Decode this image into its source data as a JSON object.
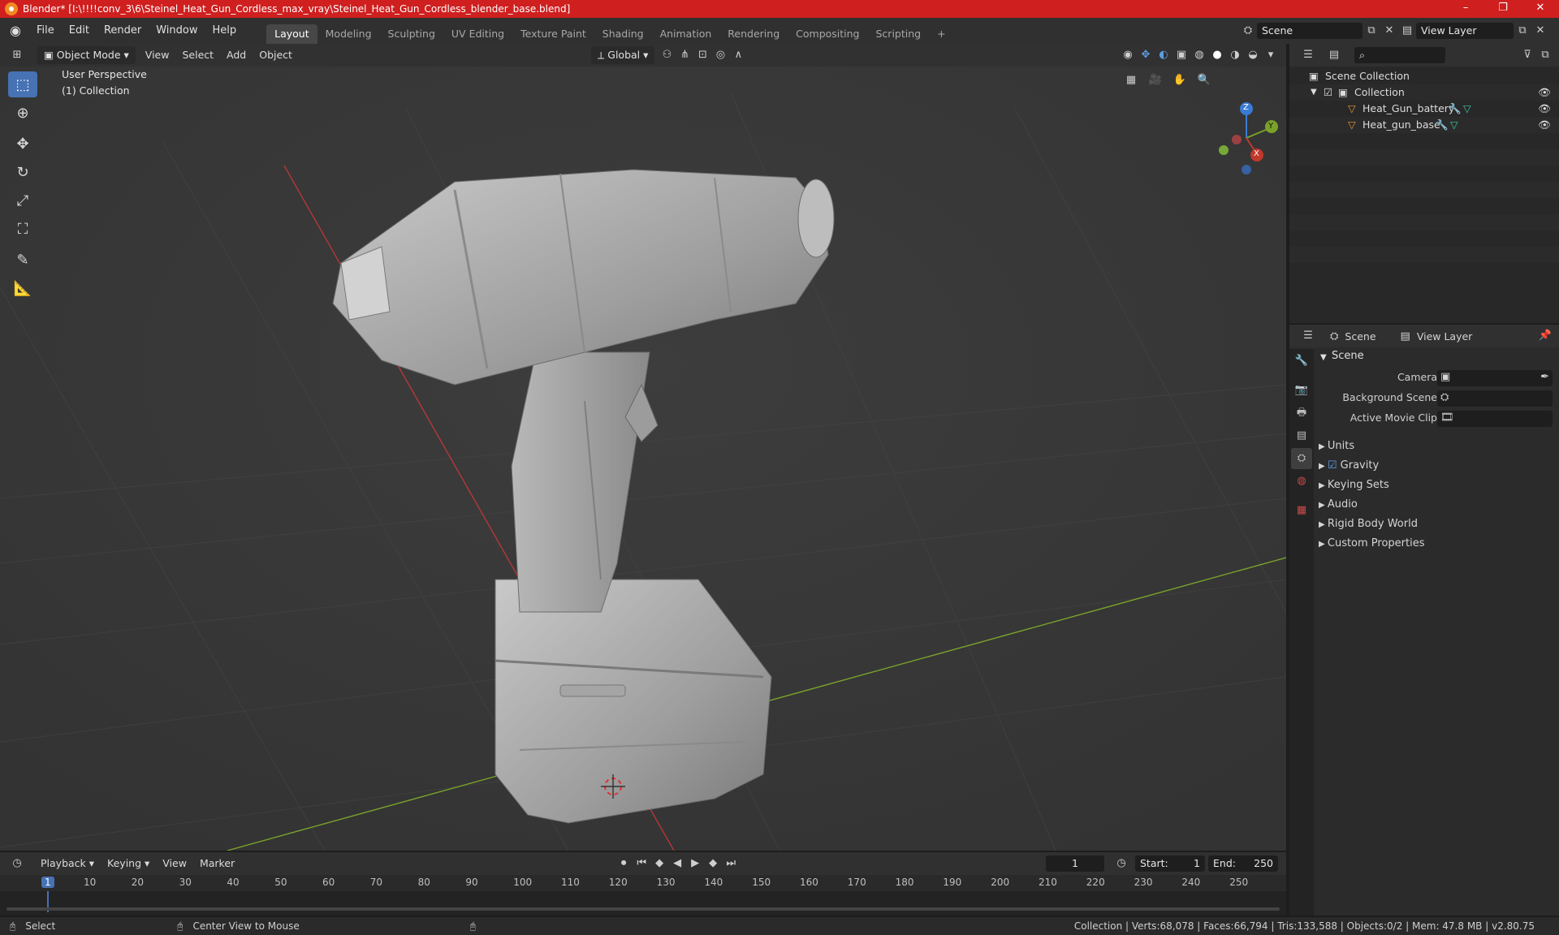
{
  "window": {
    "title": "Blender* [I:\\!!!!conv_3\\6\\Steinel_Heat_Gun_Cordless_max_vray\\Steinel_Heat_Gun_Cordless_blender_base.blend]",
    "minimize": "–",
    "maximize": "❐",
    "close": "✕"
  },
  "menu": {
    "items": [
      "File",
      "Edit",
      "Render",
      "Window",
      "Help"
    ],
    "workspaces": [
      "Layout",
      "Modeling",
      "Sculpting",
      "UV Editing",
      "Texture Paint",
      "Shading",
      "Animation",
      "Rendering",
      "Compositing",
      "Scripting"
    ],
    "active_workspace": "Layout",
    "add_workspace": "+",
    "scene_name": "Scene",
    "view_layer_name": "View Layer"
  },
  "viewport": {
    "mode": "Object Mode",
    "header_menus": [
      "View",
      "Select",
      "Add",
      "Object"
    ],
    "transform_orientation": "Global",
    "overlay_line1": "User Perspective",
    "overlay_line2": "(1) Collection",
    "gizmo": {
      "z": "Z",
      "y": "Y",
      "x": "X"
    }
  },
  "outliner": {
    "search_placeholder": "",
    "rows": [
      {
        "name": "Scene Collection"
      },
      {
        "name": "Collection"
      },
      {
        "name": "Heat_Gun_battery"
      },
      {
        "name": "Heat_gun_base"
      }
    ]
  },
  "properties": {
    "tab_scene": "Scene",
    "tab_view_layer": "View Layer",
    "panel_scene": "Scene",
    "camera_label": "Camera",
    "background_scene_label": "Background Scene",
    "active_movie_clip_label": "Active Movie Clip",
    "subpanels": [
      "Units",
      "Gravity",
      "Keying Sets",
      "Audio",
      "Rigid Body World",
      "Custom Properties"
    ],
    "gravity_checked": true
  },
  "timeline": {
    "menus": [
      "Playback",
      "Keying",
      "View",
      "Marker"
    ],
    "current_frame": "1",
    "start_label": "Start:",
    "start_value": "1",
    "end_label": "End:",
    "end_value": "250",
    "ruler_marks": [
      "1",
      "10",
      "20",
      "30",
      "40",
      "50",
      "60",
      "70",
      "80",
      "90",
      "100",
      "110",
      "120",
      "130",
      "140",
      "150",
      "160",
      "170",
      "180",
      "190",
      "200",
      "210",
      "220",
      "230",
      "240",
      "250"
    ]
  },
  "status": {
    "left_action": "Select",
    "middle_action": "Center View to Mouse",
    "stats": "Collection | Verts:68,078 | Faces:66,794 | Tris:133,588 | Objects:0/2 | Mem: 47.8 MB | v2.80.75"
  },
  "colors": {
    "titlebar": "#cf1f1f",
    "active_tool": "#4772b3",
    "x_axis": "#c0392b",
    "y_axis": "#7aa22a",
    "z_axis": "#3a7bd5"
  }
}
